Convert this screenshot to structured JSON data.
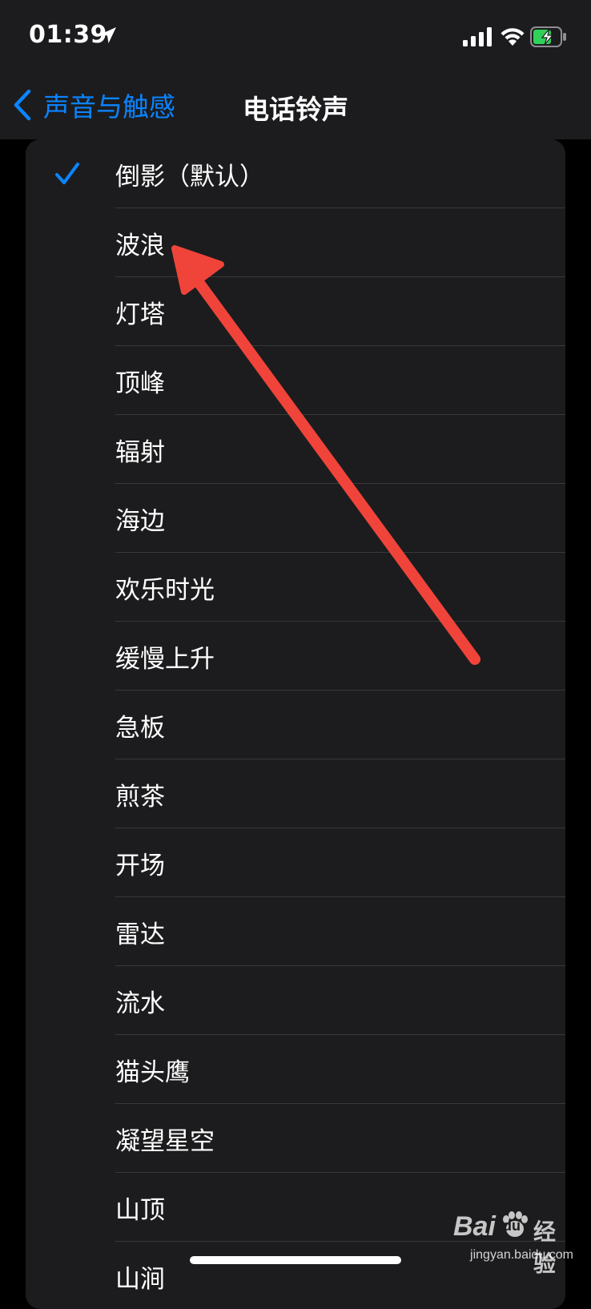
{
  "status_bar": {
    "time": "01:39",
    "location_icon": "location-arrow-icon",
    "signal_icon": "cellular-signal-icon",
    "wifi_icon": "wifi-icon",
    "battery_icon": "battery-charging-icon"
  },
  "nav": {
    "back_label": "声音与触感",
    "title": "电话铃声",
    "accent_color": "#0a84ff"
  },
  "ringtones": [
    {
      "label": "倒影（默认）",
      "selected": true
    },
    {
      "label": "波浪",
      "selected": false
    },
    {
      "label": "灯塔",
      "selected": false
    },
    {
      "label": "顶峰",
      "selected": false
    },
    {
      "label": "辐射",
      "selected": false
    },
    {
      "label": "海边",
      "selected": false
    },
    {
      "label": "欢乐时光",
      "selected": false
    },
    {
      "label": "缓慢上升",
      "selected": false
    },
    {
      "label": "急板",
      "selected": false
    },
    {
      "label": "煎茶",
      "selected": false
    },
    {
      "label": "开场",
      "selected": false
    },
    {
      "label": "雷达",
      "selected": false
    },
    {
      "label": "流水",
      "selected": false
    },
    {
      "label": "猫头鹰",
      "selected": false
    },
    {
      "label": "凝望星空",
      "selected": false
    },
    {
      "label": "山顶",
      "selected": false
    },
    {
      "label": "山涧",
      "selected": false
    }
  ],
  "annotation": {
    "type": "red-arrow",
    "color": "#f0443a",
    "points_to": "波浪"
  },
  "watermark": {
    "brand": "Bai",
    "du": "du",
    "jingyan": "经验",
    "url": "jingyan.baidu.com"
  }
}
